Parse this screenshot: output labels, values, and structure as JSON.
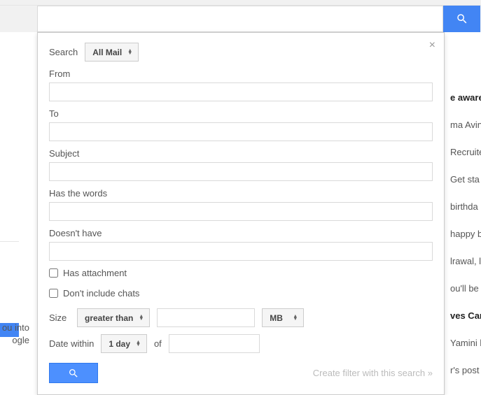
{
  "panel": {
    "search_label": "Search",
    "scope": "All Mail",
    "close": "×",
    "from_label": "From",
    "to_label": "To",
    "subject_label": "Subject",
    "haswords_label": "Has the words",
    "doesnthave_label": "Doesn't have",
    "has_attachment_label": "Has attachment",
    "dont_include_chats_label": "Don't include chats",
    "size_label": "Size",
    "size_op": "greater than",
    "size_unit": "MB",
    "date_label": "Date within",
    "date_range": "1 day",
    "of_label": "of",
    "filter_link": "Create filter with this search »"
  },
  "bg_rows": [
    {
      "text": "e aware",
      "bold": true
    },
    {
      "text": "ma Avin",
      "bold": false
    },
    {
      "text": "Recruite",
      "bold": false
    },
    {
      "text": "Get sta",
      "bold": false
    },
    {
      "text": "birthda",
      "bold": false
    },
    {
      "text": "happy b",
      "bold": false
    },
    {
      "text": "lrawal, l",
      "bold": false
    },
    {
      "text": "ou'll be a",
      "bold": false
    },
    {
      "text": "ves Car",
      "bold": true
    },
    {
      "text": "Yamini l",
      "bold": false
    },
    {
      "text": "r's post",
      "bold": false
    }
  ],
  "left": {
    "l1": "ou into",
    "l2": "ogle"
  }
}
